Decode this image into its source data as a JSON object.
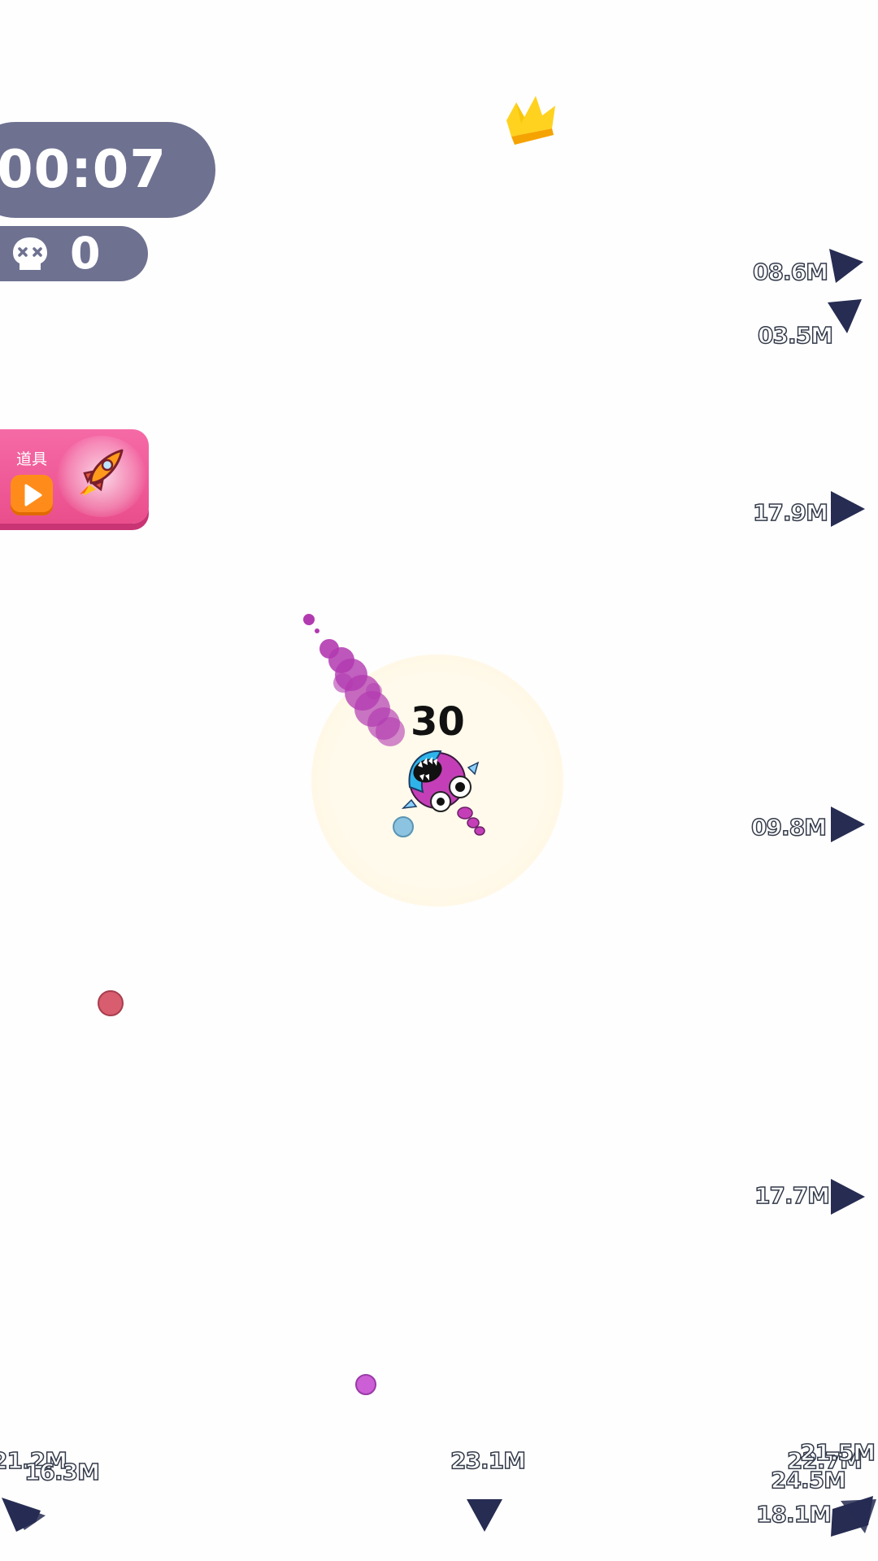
{
  "hud": {
    "timer": "00:07",
    "kills": "0",
    "skull_icon": "skull-icon"
  },
  "powerup": {
    "label": "道具",
    "play_icon": "play-icon",
    "rocket_icon": "rocket-icon",
    "colors": {
      "card": "#ea4e8c",
      "button": "#ff8c1a"
    }
  },
  "leader_indicator": {
    "icon": "crown-icon",
    "color": "#f5b800"
  },
  "player": {
    "score": "30",
    "character_icon": "fish-creature-icon",
    "trail_color": "#b23ab0"
  },
  "distance_markers": [
    {
      "label": "08.6M"
    },
    {
      "label": "03.5M"
    },
    {
      "label": "17.9M"
    },
    {
      "label": "09.8M"
    },
    {
      "label": "17.7M"
    },
    {
      "label": "23.1M"
    },
    {
      "label": "18.1M"
    },
    {
      "label": "21.2M"
    },
    {
      "label": "16.3M"
    },
    {
      "label": "22.7M"
    },
    {
      "label": "24.5M"
    },
    {
      "label": "21.5M"
    }
  ],
  "pellets": [
    {
      "color": "#d85d6e"
    },
    {
      "color": "#cc5ed6"
    },
    {
      "color": "#8cc3e0"
    }
  ]
}
